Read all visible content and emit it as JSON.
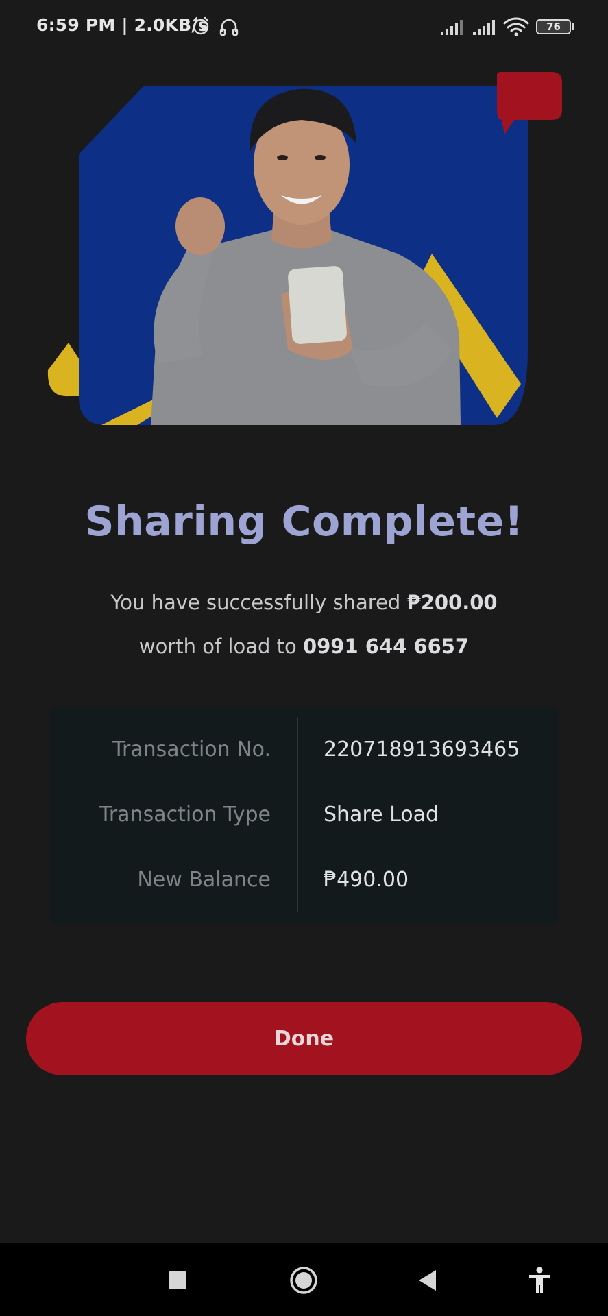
{
  "status_bar": {
    "time": "6:59 PM | 2.0KB/s",
    "battery_level": "76",
    "icons": [
      "alarm-icon",
      "headset-icon",
      "signal-icon",
      "signal-icon",
      "wifi-icon",
      "battery-icon"
    ]
  },
  "hero": {
    "image": "man-celebrating-with-phone",
    "colors": {
      "primary": "#0d2f86",
      "accent_red": "#a3131f",
      "accent_yellow": "#d9b320"
    }
  },
  "result": {
    "title": "Sharing Complete!",
    "line1_prefix": "You have successfully shared ",
    "amount": "₱200.00",
    "line2_prefix": "worth of load to ",
    "recipient": "0991 644 6657"
  },
  "details": [
    {
      "label": "Transaction No.",
      "value": "220718913693465"
    },
    {
      "label": "Transaction Type",
      "value": "Share Load"
    },
    {
      "label": "New Balance",
      "value": "₱490.00"
    }
  ],
  "done_button": {
    "label": "Done",
    "color": "#a3131f"
  },
  "nav_bar": {
    "icons": [
      "recent-apps-icon",
      "home-icon",
      "back-icon",
      "accessibility-icon"
    ]
  },
  "colors": {
    "background": "#1a1a1b",
    "title": "#9da3d2"
  }
}
